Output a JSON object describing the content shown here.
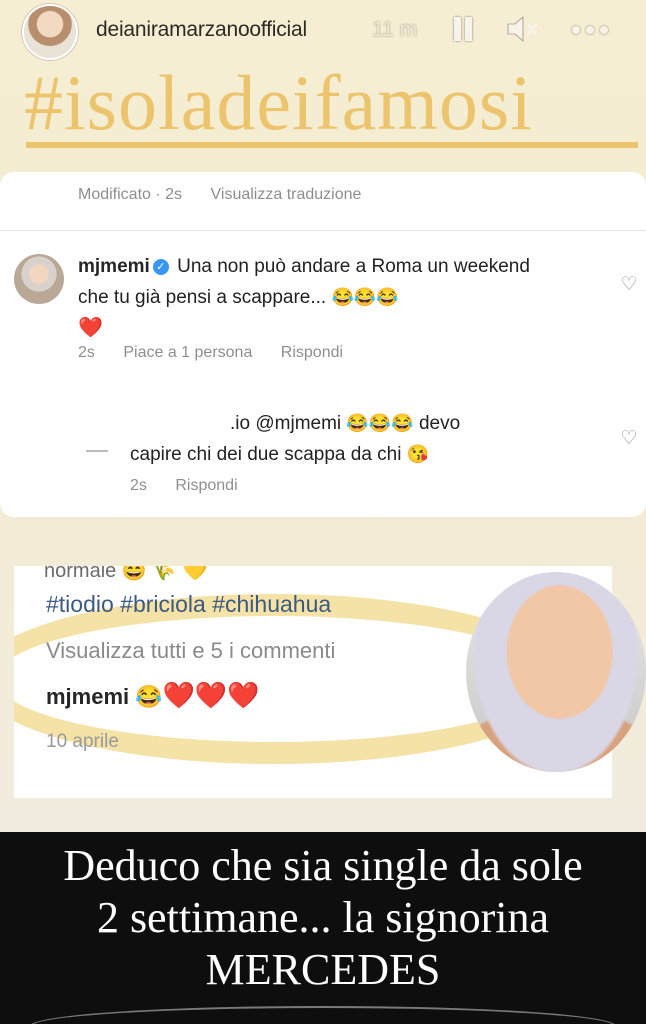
{
  "header": {
    "username": "deianiramarzanoofficial",
    "time_ago": "11 m",
    "controls": [
      "pause-icon",
      "mute-icon",
      "more-icon"
    ]
  },
  "hashtag": "#isoladeifamosi",
  "comments_card": {
    "top_meta": {
      "edited": "Modificato · 2s",
      "translate": "Visualizza traduzione"
    },
    "comment1": {
      "username": "mjmemi",
      "text": "Una non può andare a Roma un weekend che tu già pensi a scappare...",
      "emojis": "😂😂😂",
      "heart": "❤️",
      "time": "2s",
      "likes": "Piace a 1 persona",
      "reply": "Rispondi"
    },
    "comment2": {
      "prefix": ".io",
      "mention": "@mjmemi",
      "emojis": "😂😂😂",
      "text_a": "devo",
      "text_b": "capire chi dei due scappa da chi",
      "emoji_end": "😘",
      "time": "2s",
      "reply": "Rispondi"
    }
  },
  "inset": {
    "cut_text": "normale 😄 🌾 💛",
    "tags": "#tiodio #briciola #chihuahua",
    "view_all": "Visualizza tutti e 5 i commenti",
    "comment_user": "mjmemi",
    "comment_emoji": "😂",
    "hearts": "❤️❤️❤️",
    "date": "10 aprile"
  },
  "caption": {
    "line1": "Deduco che sia single da sole",
    "line2": "2 settimane... la signorina",
    "line3": "MERCEDES"
  },
  "colors": {
    "accent": "#ecc46e",
    "caption_bg": "#0e0e0e",
    "hashtag_link": "#3b5a83"
  }
}
